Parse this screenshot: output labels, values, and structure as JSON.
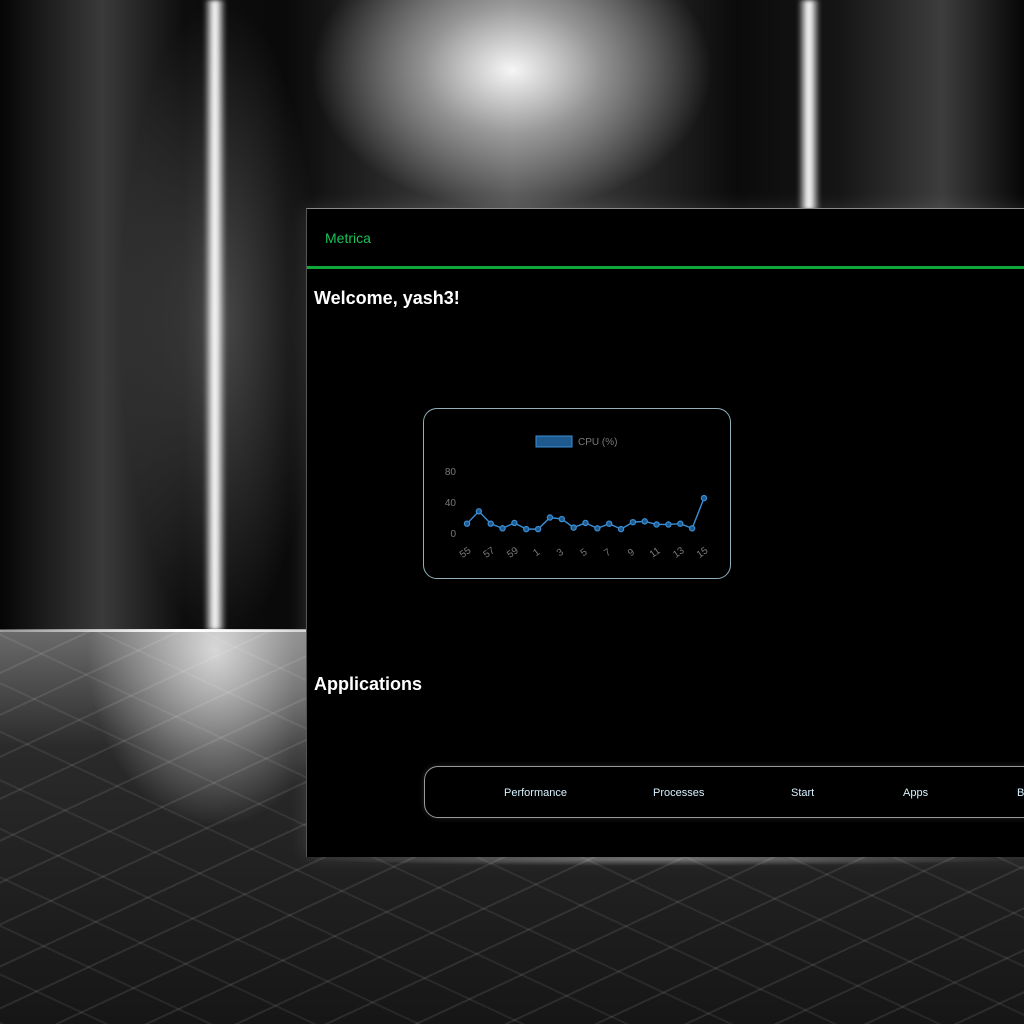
{
  "app": {
    "brand": "Metrica",
    "accent_color": "#0fa63b"
  },
  "main": {
    "welcome": "Welcome, yash3!",
    "applications_title": "Applications"
  },
  "bottom_nav": {
    "items": [
      "Performance",
      "Processes",
      "Start",
      "Apps",
      "B"
    ]
  },
  "chart_data": {
    "type": "line",
    "title": "",
    "xlabel": "",
    "ylabel": "",
    "legend": {
      "label": "CPU (%)",
      "placement": "top"
    },
    "ylim": [
      0,
      80
    ],
    "yticks": [
      0,
      40,
      80
    ],
    "x_tick_labels": [
      "55",
      "57",
      "59",
      "1",
      "3",
      "5",
      "7",
      "9",
      "11",
      "13",
      "15"
    ],
    "series": [
      {
        "name": "CPU (%)",
        "color": "#3a8fd6",
        "values": [
          12,
          28,
          12,
          6,
          13,
          5,
          5,
          20,
          18,
          7,
          13,
          6,
          12,
          5,
          14,
          15,
          11,
          11,
          12,
          6,
          45
        ]
      }
    ]
  }
}
